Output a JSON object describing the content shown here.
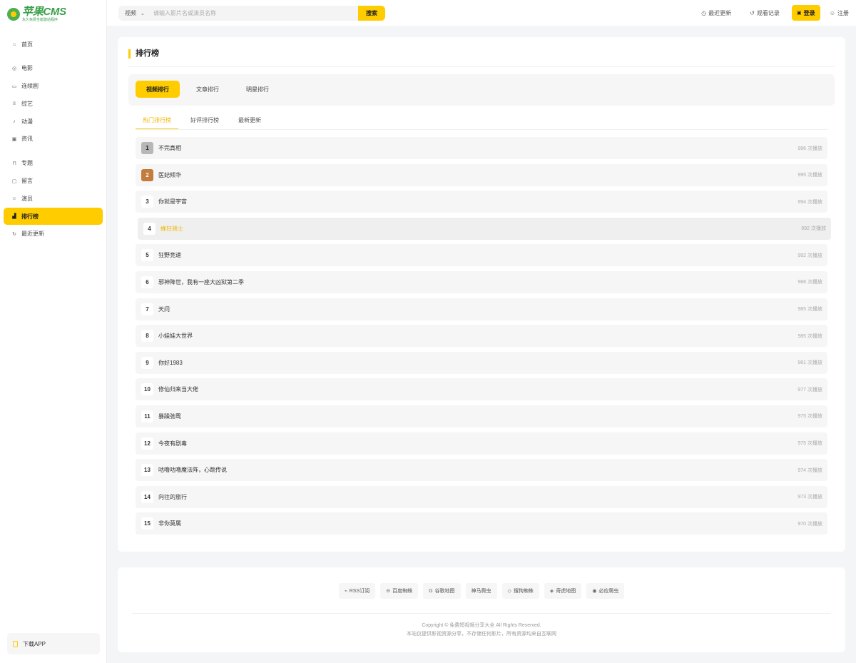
{
  "logo": {
    "title": "苹果CMS",
    "subtitle": "永久免费全能建站程序"
  },
  "sidebar": {
    "items": [
      {
        "label": "首页",
        "icon": "home-icon",
        "glyph": "⌂"
      },
      {
        "label": "电影",
        "icon": "film-icon",
        "glyph": "◎"
      },
      {
        "label": "连续剧",
        "icon": "tv-icon",
        "glyph": "▭"
      },
      {
        "label": "综艺",
        "icon": "variety-icon",
        "glyph": "♕"
      },
      {
        "label": "动漫",
        "icon": "anime-icon",
        "glyph": "♪"
      },
      {
        "label": "资讯",
        "icon": "news-icon",
        "glyph": "▣"
      },
      {
        "label": "专题",
        "icon": "bookmark-icon",
        "glyph": "⊓"
      },
      {
        "label": "留言",
        "icon": "message-icon",
        "glyph": "▢"
      },
      {
        "label": "演员",
        "icon": "user-icon",
        "glyph": "☺"
      },
      {
        "label": "排行榜",
        "icon": "chart-icon",
        "glyph": "▟"
      },
      {
        "label": "最近更新",
        "icon": "refresh-icon",
        "glyph": "↻"
      }
    ],
    "active_index": 9,
    "download_app": "下载APP"
  },
  "header": {
    "search_type": "视频",
    "search_placeholder": "请输入影片名或演员名称",
    "search_button": "搜索",
    "recent_updates": "最近更新",
    "watch_history": "观看记录",
    "login": "登录",
    "register": "注册"
  },
  "main": {
    "title": "排行榜",
    "tabs": [
      "视频排行",
      "文章排行",
      "明星排行"
    ],
    "active_tab": 0,
    "subtabs": [
      "热门排行榜",
      "好评排行榜",
      "最新更新"
    ],
    "active_subtab": 0,
    "rank_list": [
      {
        "rank": "1",
        "name": "不完真相",
        "plays": "996 次播放"
      },
      {
        "rank": "2",
        "name": "医妃倾华",
        "plays": "995 次播放"
      },
      {
        "rank": "3",
        "name": "你就是宇宙",
        "plays": "994 次播放"
      },
      {
        "rank": "4",
        "name": "蜂狂骑士",
        "plays": "992 次播放"
      },
      {
        "rank": "5",
        "name": "狂野竞速",
        "plays": "992 次播放"
      },
      {
        "rank": "6",
        "name": "邪神降世，我有一座大凶狱第二季",
        "plays": "988 次播放"
      },
      {
        "rank": "7",
        "name": "天问",
        "plays": "985 次播放"
      },
      {
        "rank": "8",
        "name": "小娃娃大世界",
        "plays": "985 次播放"
      },
      {
        "rank": "9",
        "name": "你好1983",
        "plays": "981 次播放"
      },
      {
        "rank": "10",
        "name": "修仙归来当大佬",
        "plays": "977 次播放"
      },
      {
        "rank": "11",
        "name": "暴躁弛鸷",
        "plays": "975 次播放"
      },
      {
        "rank": "12",
        "name": "今夜有剧毒",
        "plays": "975 次播放"
      },
      {
        "rank": "13",
        "name": "咕噜咕噜魔法阵，心跳传说",
        "plays": "974 次播放"
      },
      {
        "rank": "14",
        "name": "向往的旅行",
        "plays": "973 次播放"
      },
      {
        "rank": "15",
        "name": "非你莫属",
        "plays": "970 次播放"
      }
    ],
    "highlight_index": 3
  },
  "footer": {
    "links": [
      {
        "label": "RSS订阅",
        "icon": "rss-icon",
        "glyph": "⌁"
      },
      {
        "label": "百度蜘蛛",
        "icon": "baidu-icon",
        "glyph": "⊖"
      },
      {
        "label": "谷歌地图",
        "icon": "google-icon",
        "glyph": "G"
      },
      {
        "label": "神马爬虫",
        "icon": "",
        "glyph": ""
      },
      {
        "label": "搜狗蜘蛛",
        "icon": "sogou-icon",
        "glyph": "◇"
      },
      {
        "label": "奇虎地图",
        "icon": "qihoo-icon",
        "glyph": "◈"
      },
      {
        "label": "必应爬虫",
        "icon": "bing-icon",
        "glyph": "◉"
      }
    ],
    "copyright_line1": "Copyright © 免费短视频分享大全 All Rights Reserved.",
    "copyright_line2": "本站仅提供影视资源分享，不存储任何影片，所有资源均来自互联网"
  },
  "colors": {
    "accent": "#ffcc00",
    "highlight_text": "#f2b600",
    "rank2": "#c37c3c",
    "rank1": "#b7b7b7"
  }
}
